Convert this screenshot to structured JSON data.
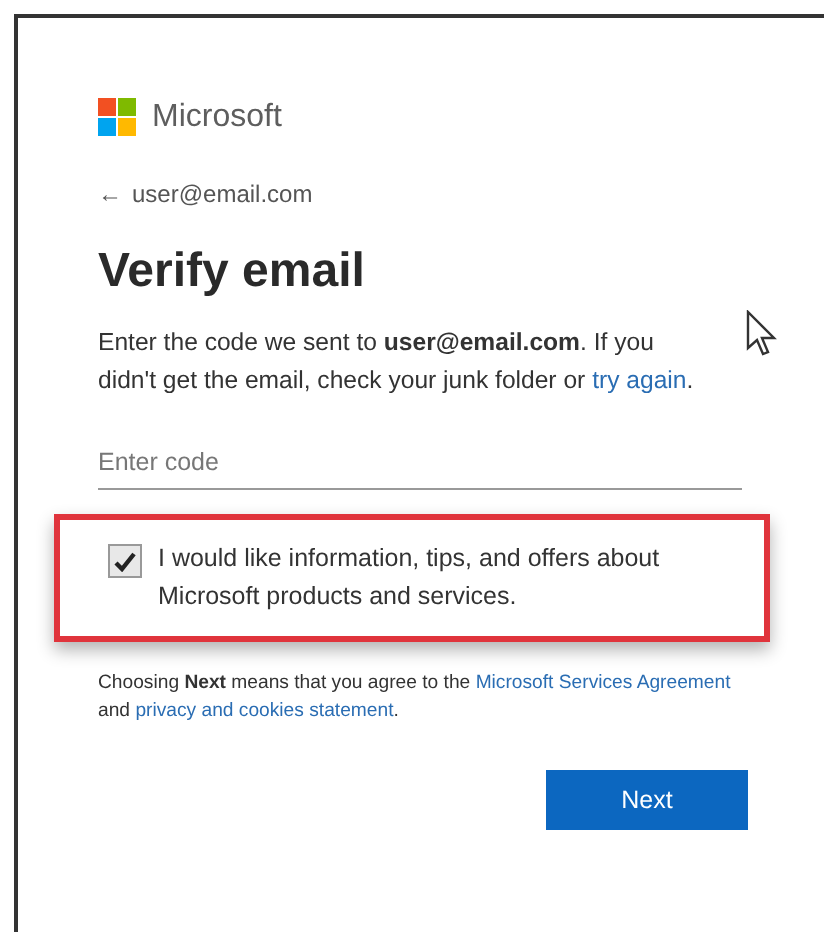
{
  "brand": {
    "name": "Microsoft"
  },
  "back": {
    "arrow": "←",
    "account": "user@email.com"
  },
  "title": "Verify email",
  "instructions": [
    {
      "kind": "text",
      "text": "Enter the code we sent to **user@email.com**. If you didn't get the email, check your junk folder or "
    },
    {
      "kind": "link",
      "text": "try again"
    },
    {
      "kind": "text",
      "text": "."
    }
  ],
  "code_field": {
    "placeholder": "Enter code"
  },
  "consent": {
    "checked": true,
    "highlighted": true,
    "label": "I would like information, tips, and offers about Microsoft products and services."
  },
  "legal": [
    {
      "kind": "text",
      "text": "Choosing **Next** means that you agree to the "
    },
    {
      "kind": "link",
      "text": "Microsoft Services Agreement"
    },
    {
      "kind": "text",
      "text": " and "
    },
    {
      "kind": "link",
      "text": "privacy and cookies statement"
    },
    {
      "kind": "text",
      "text": "."
    }
  ],
  "next_button": "Next"
}
